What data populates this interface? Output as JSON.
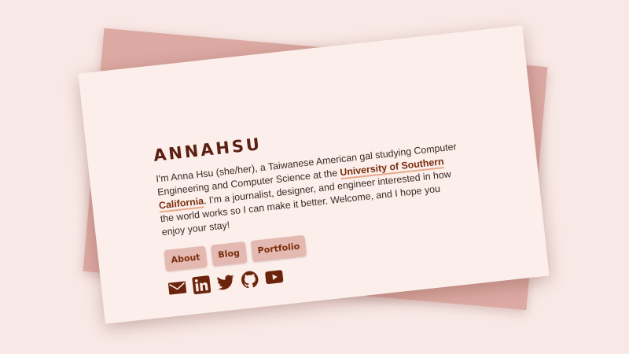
{
  "profile": {
    "name": "ANNAHSU",
    "bio_intro": "I'm Anna Hsu (she/her), a Taiwanese American gal studying Computer Engineering and Computer Science at the ",
    "bio_link": "University of Southern California",
    "bio_outro": ". I'm a journalist, designer, and engineer interested in how the world works so I can make it better. Welcome, and I hope you enjoy your stay!"
  },
  "nav": {
    "about": "About",
    "blog": "Blog",
    "portfolio": "Portfolio"
  },
  "socials": [
    "mail-icon",
    "linkedin-icon",
    "twitter-icon",
    "github-icon",
    "youtube-icon"
  ],
  "colors": {
    "background": "#f9e9e6",
    "back_card": "#dcaaa3",
    "front_card": "#fbeeeb",
    "accent": "#7a2e0d",
    "button_bg": "#e4b9b1",
    "link_underline": "#e9a987"
  }
}
